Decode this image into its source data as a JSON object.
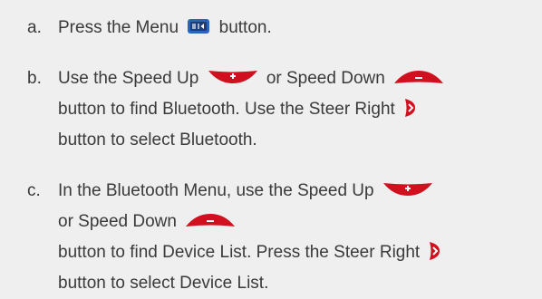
{
  "steps": [
    {
      "marker": "a.",
      "parts": [
        {
          "t": "text",
          "v": "Press the Menu "
        },
        {
          "t": "icon",
          "icon": "menu-button-icon"
        },
        {
          "t": "text",
          "v": " button."
        }
      ]
    },
    {
      "marker": "b.",
      "parts": [
        {
          "t": "text",
          "v": "Use the Speed Up "
        },
        {
          "t": "icon",
          "icon": "speed-up-button-icon"
        },
        {
          "t": "text",
          "v": " or Speed Down "
        },
        {
          "t": "icon",
          "icon": "speed-down-button-icon"
        },
        {
          "t": "text",
          "v": " button to find Bluetooth. Use the Steer Right "
        },
        {
          "t": "icon",
          "icon": "steer-right-button-icon"
        },
        {
          "t": "text",
          "v": " button to select Bluetooth."
        }
      ]
    },
    {
      "marker": "c.",
      "parts": [
        {
          "t": "text",
          "v": "In the Bluetooth Menu, use the Speed Up "
        },
        {
          "t": "icon",
          "icon": "speed-up-button-icon"
        },
        {
          "t": "text",
          "v": " or Speed Down "
        },
        {
          "t": "icon",
          "icon": "speed-down-button-icon"
        },
        {
          "t": "text",
          "v": " button to find Device List. Press the Steer Right "
        },
        {
          "t": "icon",
          "icon": "steer-right-button-icon"
        },
        {
          "t": "text",
          "v": " button to select Device List."
        }
      ]
    }
  ],
  "colors": {
    "text": "#3a3a3a",
    "background": "#efefef",
    "button_red": "#d0101e",
    "menu_blue": "#2b64b8"
  }
}
